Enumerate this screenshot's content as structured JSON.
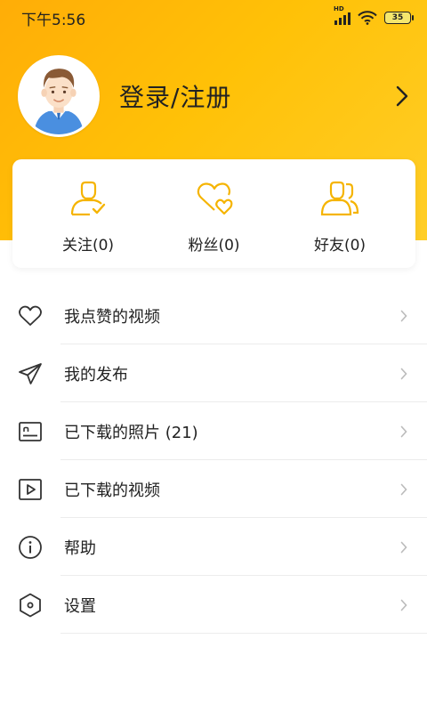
{
  "status_bar": {
    "time": "下午5:56",
    "network": "HD",
    "battery": "35"
  },
  "profile": {
    "avatar_icon": "user-avatar-icon",
    "login_label": "登录/注册",
    "arrow_icon": "chevron-right-icon"
  },
  "stats": [
    {
      "label": "关注(0)",
      "icon": "follow-user-icon"
    },
    {
      "label": "粉丝(0)",
      "icon": "fans-heart-icon"
    },
    {
      "label": "好友(0)",
      "icon": "friends-icon"
    }
  ],
  "menu": [
    {
      "label": "我点赞的视频",
      "icon": "heart-icon"
    },
    {
      "label": "我的发布",
      "icon": "paper-plane-icon"
    },
    {
      "label": "已下载的照片 (21)",
      "icon": "photo-icon"
    },
    {
      "label": "已下载的视频",
      "icon": "video-play-icon"
    },
    {
      "label": "帮助",
      "icon": "info-icon"
    },
    {
      "label": "设置",
      "icon": "settings-hexagon-icon"
    }
  ],
  "colors": {
    "accent": "#FFB400",
    "header_gradient_start": "#FFAD07",
    "header_gradient_end": "#FFCE28",
    "icon_dark": "#333333",
    "chevron": "#BBBBBB"
  }
}
